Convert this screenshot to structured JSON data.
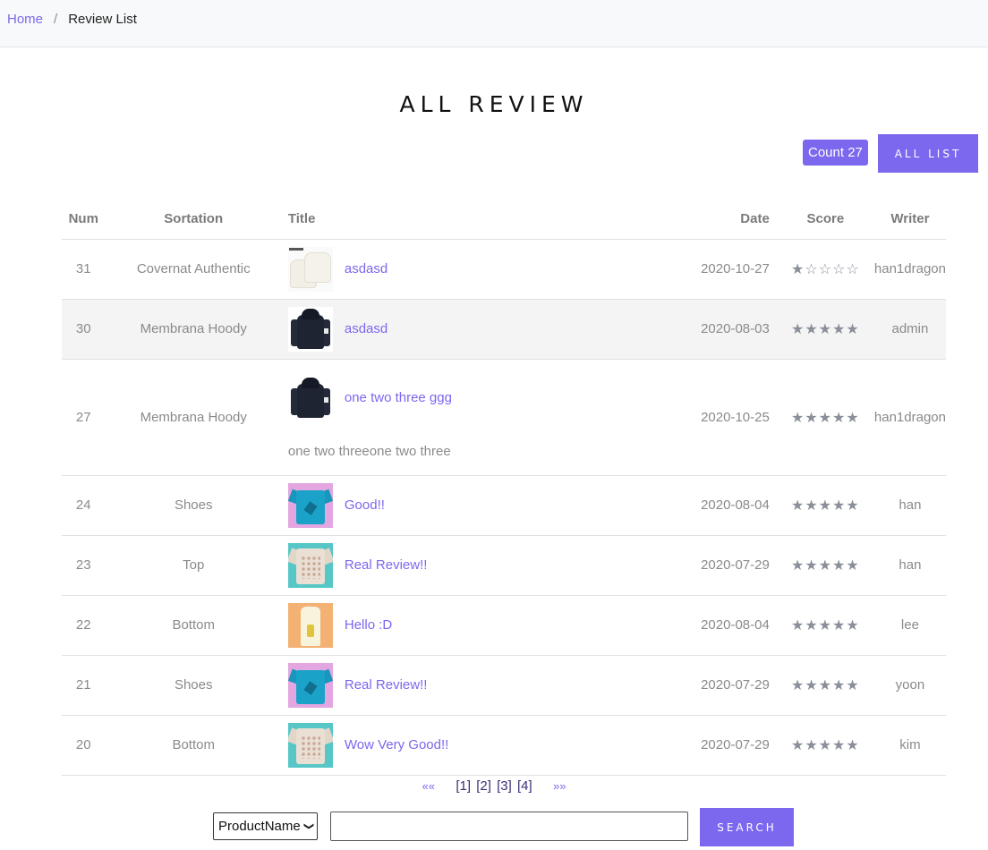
{
  "breadcrumb": {
    "home": "Home",
    "separator": "/",
    "current": "Review List"
  },
  "page_title": "ALL REVIEW",
  "count_label": "Count 27",
  "all_list_label": "ALL LIST",
  "table": {
    "headers": {
      "num": "Num",
      "sortation": "Sortation",
      "title": "Title",
      "date": "Date",
      "score": "Score",
      "writer": "Writer"
    },
    "rows": [
      {
        "num": "31",
        "sortation": "Covernat Authentic",
        "title": "asdasd",
        "date": "2020-10-27",
        "score": "★☆☆☆☆",
        "writer": "han1dragon",
        "thumb": "white-jacket-thumb"
      },
      {
        "num": "30",
        "sortation": "Membrana Hoody",
        "title": "asdasd",
        "date": "2020-08-03",
        "score": "★★★★★",
        "writer": "admin",
        "thumb": "dark-hoody-thumb"
      },
      {
        "num": "27",
        "sortation": "Membrana Hoody",
        "title": "one two three ggg",
        "content": "one two threeone two three",
        "date": "2020-10-25",
        "score": "★★★★★",
        "writer": "han1dragon",
        "thumb": "dark-hoody-thumb"
      },
      {
        "num": "24",
        "sortation": "Shoes",
        "title": "Good!!",
        "date": "2020-08-04",
        "score": "★★★★★",
        "writer": "han",
        "thumb": "blue-shirt-thumb"
      },
      {
        "num": "23",
        "sortation": "Top",
        "title": "Real Review!!",
        "date": "2020-07-29",
        "score": "★★★★★",
        "writer": "han",
        "thumb": "beige-shirt-thumb"
      },
      {
        "num": "22",
        "sortation": "Bottom",
        "title": "Hello :D",
        "date": "2020-08-04",
        "score": "★★★★★",
        "writer": "lee",
        "thumb": "tank-top-thumb"
      },
      {
        "num": "21",
        "sortation": "Shoes",
        "title": "Real Review!!",
        "date": "2020-07-29",
        "score": "★★★★★",
        "writer": "yoon",
        "thumb": "blue-shirt-thumb"
      },
      {
        "num": "20",
        "sortation": "Bottom",
        "title": "Wow Very Good!!",
        "date": "2020-07-29",
        "score": "★★★★★",
        "writer": "kim",
        "thumb": "beige-shirt-thumb"
      }
    ]
  },
  "pagination": {
    "prev": "««",
    "pages": [
      "[1]",
      "[2]",
      "[3]",
      "[4]"
    ],
    "next": "»»"
  },
  "search": {
    "select_value": "ProductName",
    "input_value": "",
    "button_label": "SEARCH"
  },
  "colors": {
    "accent": "#7b68ee",
    "highlight_row": "#f4f4f4"
  }
}
